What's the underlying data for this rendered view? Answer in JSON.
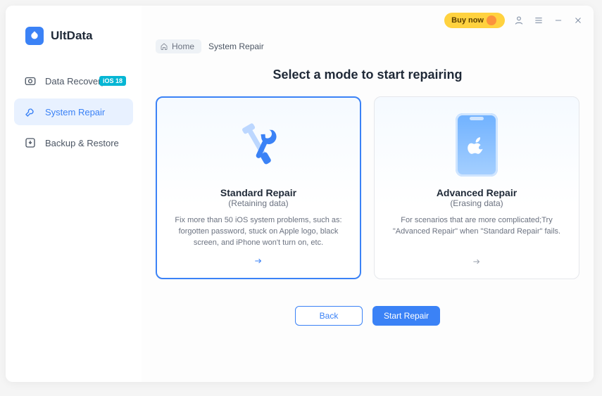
{
  "brand": {
    "name": "UltData"
  },
  "sidebar": {
    "items": [
      {
        "label": "Data Recovery",
        "badge": "iOS 18"
      },
      {
        "label": "System Repair"
      },
      {
        "label": "Backup & Restore"
      }
    ]
  },
  "titlebar": {
    "buy_now": "Buy now"
  },
  "breadcrumb": {
    "home": "Home",
    "current": "System Repair"
  },
  "page": {
    "title": "Select a mode to start repairing"
  },
  "cards": {
    "standard": {
      "title": "Standard Repair",
      "subtitle": "(Retaining data)",
      "desc": "Fix more than 50 iOS system problems, such as: forgotten password, stuck on Apple logo, black screen, and iPhone won't turn on, etc."
    },
    "advanced": {
      "title": "Advanced Repair",
      "subtitle": "(Erasing data)",
      "desc": "For scenarios that are more complicated;Try \"Advanced Repair\" when \"Standard Repair\" fails."
    }
  },
  "buttons": {
    "back": "Back",
    "start": "Start Repair"
  }
}
